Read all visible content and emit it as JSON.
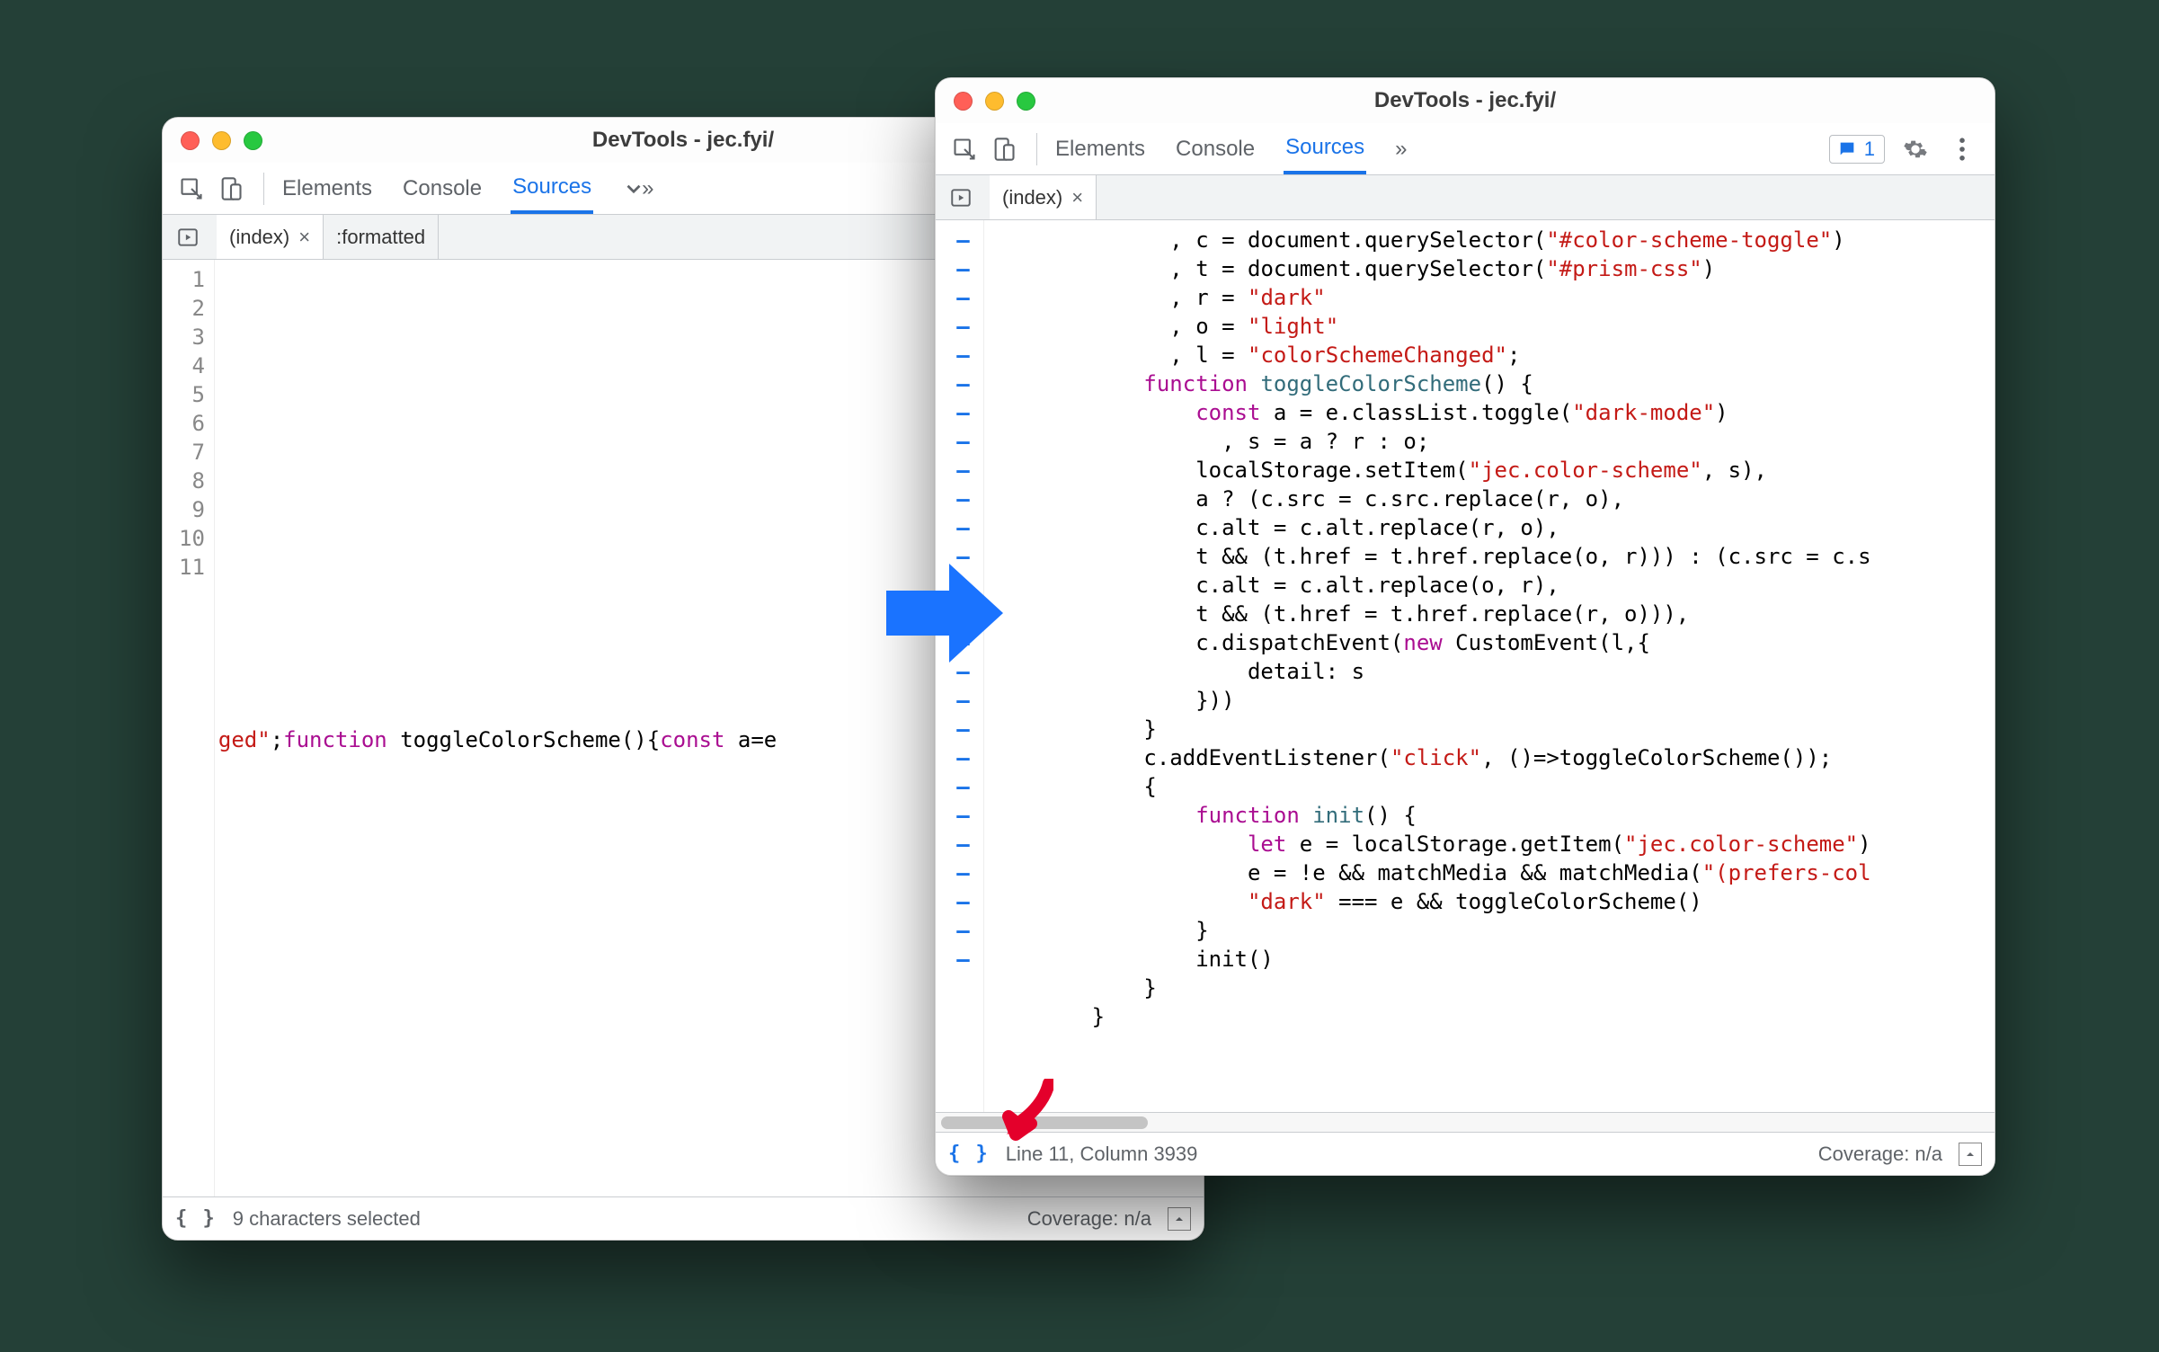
{
  "left": {
    "title": "DevTools - jec.fyi/",
    "tabs": {
      "elements": "Elements",
      "console": "Console",
      "sources": "Sources"
    },
    "file_tabs": {
      "index": "(index)",
      "formatted": ":formatted"
    },
    "gutter": [
      "1",
      "2",
      "3",
      "4",
      "5",
      "6",
      "7",
      "8",
      "9",
      "10",
      "11"
    ],
    "code_line11": {
      "frag1": "ged\"",
      "semi": ";",
      "kw_function": "function",
      "fn_name": " toggleColorScheme(){",
      "kw_const": "const",
      "rest": " a=e"
    },
    "status": {
      "left": "9 characters selected",
      "coverage": "Coverage: n/a"
    }
  },
  "right": {
    "title": "DevTools - jec.fyi/",
    "tabs": {
      "elements": "Elements",
      "console": "Console",
      "sources": "Sources"
    },
    "issues_count": "1",
    "file_tabs": {
      "index": "(index)"
    },
    "gutter_count": 26,
    "code": [
      {
        "indent": "              , ",
        "parts": [
          {
            "t": "c"
          },
          {
            "t": " = document.querySelector("
          },
          {
            "cls": "str",
            "t": "\"#color-scheme-toggle\""
          },
          {
            "t": ")"
          }
        ]
      },
      {
        "indent": "              , ",
        "parts": [
          {
            "t": "t"
          },
          {
            "t": " = document.querySelector("
          },
          {
            "cls": "str",
            "t": "\"#prism-css\""
          },
          {
            "t": ")"
          }
        ]
      },
      {
        "indent": "              , ",
        "parts": [
          {
            "t": "r"
          },
          {
            "t": " = "
          },
          {
            "cls": "str",
            "t": "\"dark\""
          }
        ]
      },
      {
        "indent": "              , ",
        "parts": [
          {
            "t": "o"
          },
          {
            "t": " = "
          },
          {
            "cls": "str",
            "t": "\"light\""
          }
        ]
      },
      {
        "indent": "              , ",
        "parts": [
          {
            "t": "l"
          },
          {
            "t": " = "
          },
          {
            "cls": "str",
            "t": "\"colorSchemeChanged\""
          },
          {
            "t": ";"
          }
        ]
      },
      {
        "indent": "            ",
        "parts": [
          {
            "cls": "kw",
            "t": "function"
          },
          {
            "t": " "
          },
          {
            "cls": "fn",
            "t": "toggleColorScheme"
          },
          {
            "t": "() {"
          }
        ]
      },
      {
        "indent": "                ",
        "parts": [
          {
            "cls": "kw",
            "t": "const"
          },
          {
            "t": " a = e.classList.toggle("
          },
          {
            "cls": "str",
            "t": "\"dark-mode\""
          },
          {
            "t": ")"
          }
        ]
      },
      {
        "indent": "                  , ",
        "parts": [
          {
            "t": "s = a ? r : o;"
          }
        ]
      },
      {
        "indent": "                ",
        "parts": [
          {
            "t": "localStorage.setItem("
          },
          {
            "cls": "str",
            "t": "\"jec.color-scheme\""
          },
          {
            "t": ", s),"
          }
        ]
      },
      {
        "indent": "                ",
        "parts": [
          {
            "t": "a ? (c.src = c.src.replace(r, o),"
          }
        ]
      },
      {
        "indent": "                ",
        "parts": [
          {
            "t": "c.alt = c.alt.replace(r, o),"
          }
        ]
      },
      {
        "indent": "                ",
        "parts": [
          {
            "t": "t && (t.href = t.href.replace(o, r))) : (c.src = c.s"
          }
        ]
      },
      {
        "indent": "                ",
        "parts": [
          {
            "t": "c.alt = c.alt.replace(o, r),"
          }
        ]
      },
      {
        "indent": "                ",
        "parts": [
          {
            "t": "t && (t.href = t.href.replace(r, o))),"
          }
        ]
      },
      {
        "indent": "                ",
        "parts": [
          {
            "t": "c.dispatchEvent("
          },
          {
            "cls": "kw",
            "t": "new"
          },
          {
            "t": " CustomEvent(l,{"
          }
        ]
      },
      {
        "indent": "                    ",
        "parts": [
          {
            "t": "detail: s"
          }
        ]
      },
      {
        "indent": "                ",
        "parts": [
          {
            "t": "}))"
          }
        ]
      },
      {
        "indent": "            ",
        "parts": [
          {
            "t": "}"
          }
        ]
      },
      {
        "indent": "            ",
        "parts": [
          {
            "t": "c.addEventListener("
          },
          {
            "cls": "str",
            "t": "\"click\""
          },
          {
            "t": ", ()=>toggleColorScheme());"
          }
        ]
      },
      {
        "indent": "            ",
        "parts": [
          {
            "t": "{"
          }
        ]
      },
      {
        "indent": "                ",
        "parts": [
          {
            "cls": "kw",
            "t": "function"
          },
          {
            "t": " "
          },
          {
            "cls": "fn",
            "t": "init"
          },
          {
            "t": "() {"
          }
        ]
      },
      {
        "indent": "                    ",
        "parts": [
          {
            "cls": "kw",
            "t": "let"
          },
          {
            "t": " e = localStorage.getItem("
          },
          {
            "cls": "str",
            "t": "\"jec.color-scheme\""
          },
          {
            "t": ")"
          }
        ]
      },
      {
        "indent": "                    ",
        "parts": [
          {
            "t": "e = !e && matchMedia && matchMedia("
          },
          {
            "cls": "str",
            "t": "\"(prefers-col"
          }
        ]
      },
      {
        "indent": "                    ",
        "parts": [
          {
            "cls": "str",
            "t": "\"dark\""
          },
          {
            "t": " === e && toggleColorScheme()"
          }
        ]
      },
      {
        "indent": "                ",
        "parts": [
          {
            "t": "}"
          }
        ]
      },
      {
        "indent": "                ",
        "parts": [
          {
            "t": "init()"
          }
        ]
      },
      {
        "indent": "            ",
        "parts": [
          {
            "t": "}"
          }
        ]
      },
      {
        "indent": "        ",
        "parts": [
          {
            "t": "}"
          }
        ]
      }
    ],
    "status": {
      "left": "Line 11, Column 3939",
      "coverage": "Coverage: n/a"
    }
  }
}
